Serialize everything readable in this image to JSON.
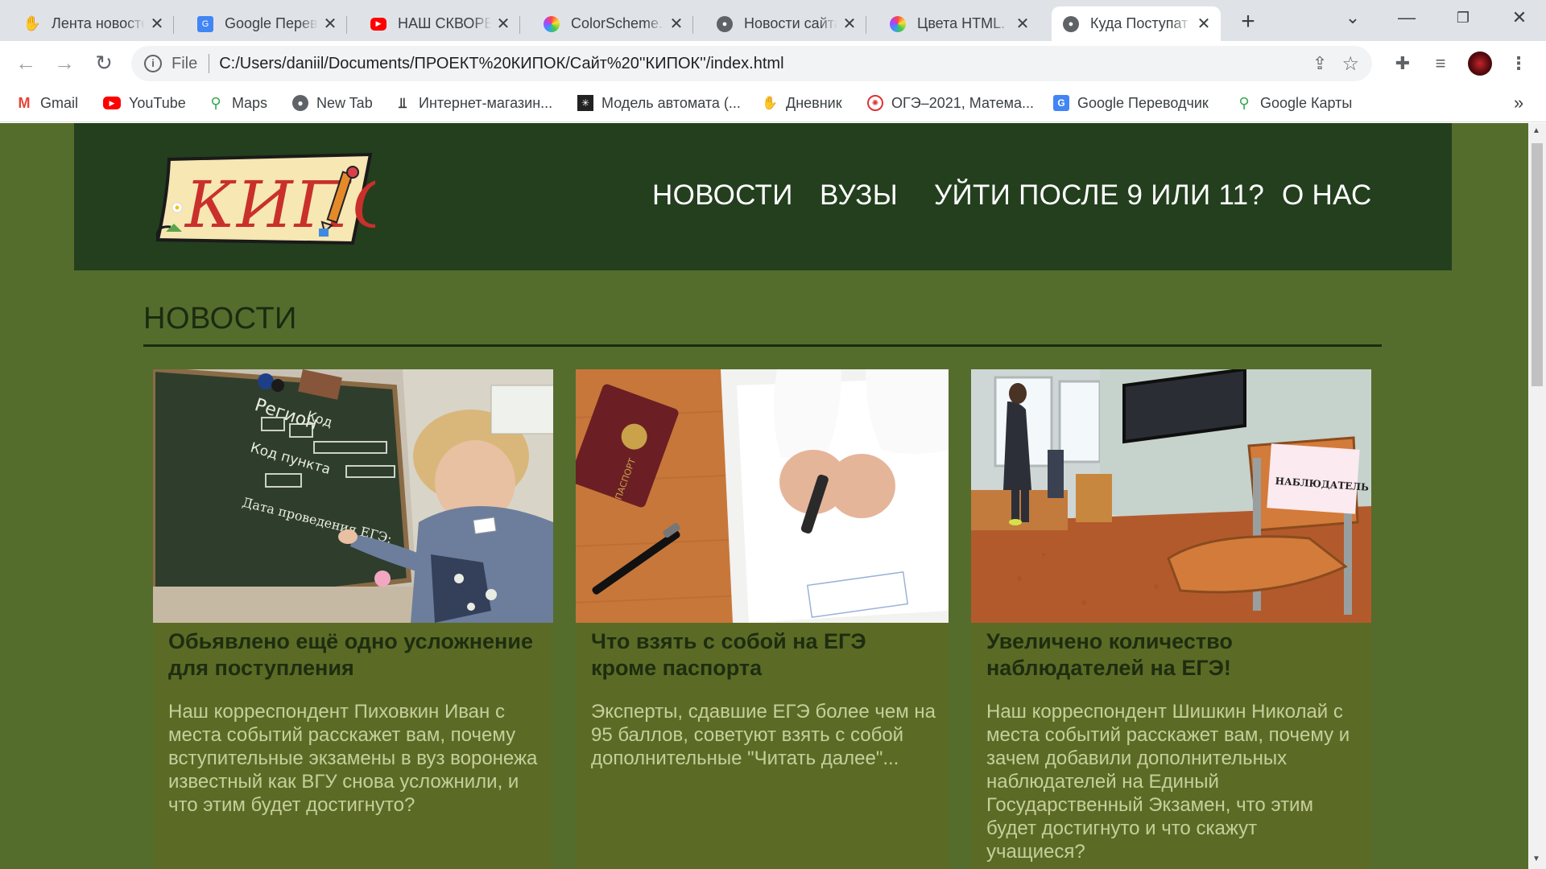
{
  "browser": {
    "tabs": [
      {
        "title": "Лента новосте",
        "favicon": "yandex-hand-icon"
      },
      {
        "title": "Google Перево",
        "favicon": "google-translate-icon"
      },
      {
        "title": "НАШ СКВОРЕЧ",
        "favicon": "youtube-icon"
      },
      {
        "title": "ColorScheme.R",
        "favicon": "color-wheel-icon"
      },
      {
        "title": "Новости сайта",
        "favicon": "globe-icon"
      },
      {
        "title": "Цвета HTML. Т",
        "favicon": "color-wheel-icon"
      },
      {
        "title": "Куда Поступат",
        "favicon": "globe-icon"
      }
    ],
    "new_tab_label": "+",
    "address": {
      "scheme_label": "File",
      "url": "C:/Users/daniil/Documents/ПРОЕКТ%20КИПОК/Сайт%20''КИПОК''/index.html"
    },
    "bookmarks": [
      {
        "label": "Gmail",
        "icon": "gmail-icon"
      },
      {
        "label": "YouTube",
        "icon": "youtube-icon"
      },
      {
        "label": "Maps",
        "icon": "maps-pin-icon"
      },
      {
        "label": "New Tab",
        "icon": "globe-icon"
      },
      {
        "label": "Интернет-магазин...",
        "icon": "shop-icon"
      },
      {
        "label": "Модель автомата (...",
        "icon": "automaton-icon"
      },
      {
        "label": "Дневник",
        "icon": "diary-hand-icon"
      },
      {
        "label": "ОГЭ–2021, Матема...",
        "icon": "oge-icon"
      },
      {
        "label": "Google Переводчик",
        "icon": "google-translate-icon"
      },
      {
        "label": "Google Карты",
        "icon": "maps-pin-icon"
      }
    ],
    "bookmarks_more": "»"
  },
  "site": {
    "logo_text": "КИПОК",
    "nav": [
      "НОВОСТИ",
      "ВУЗЫ",
      "УЙТИ ПОСЛЕ 9 ИЛИ 11?",
      "О НАС"
    ],
    "section_title": "НОВОСТИ",
    "cards": [
      {
        "title": "Обьявлено ещё одно усложнение для поступления",
        "text": "Наш корреспондент Пиховкин Иван с места событий расскажет вам, почему вступительные экзамены в вуз воронежа известный как ВГУ снова усложнили, и что этим будет достигнуто?",
        "image": "teacher-at-chalkboard",
        "image_text": [
          "Регион",
          "Код",
          "Код пункта",
          "Дата проведения ЕГЭ:"
        ]
      },
      {
        "title": "Что взять с собой на ЕГЭ кроме паспорта",
        "text": "Эксперты, сдавшие ЕГЭ более чем на 95 баллов, советуют взять с собой дополнительные \"Читать далее\"...",
        "image": "passport-and-pen",
        "image_text": [
          "ПАСПОРТ"
        ]
      },
      {
        "title": "Увеличено количество наблюдателей на ЕГЭ!",
        "text": "Наш корреспондент Шишкин Николай с места событий расскажет вам, почему и зачем добавили дополнительных наблюдателей на Единый Государственный Экзамен, что этим будет достигнуто и что скажут учащиеся?",
        "image": "observer-chair-classroom",
        "image_text": [
          "НАБЛЮДАТЕЛЬ"
        ]
      }
    ]
  },
  "colors": {
    "page_bg": "#546d2d",
    "header_bg": "#233f1e",
    "card_bg": "#5b6b25",
    "card_title": "#1e2d10",
    "card_text": "#c6cf9c"
  }
}
